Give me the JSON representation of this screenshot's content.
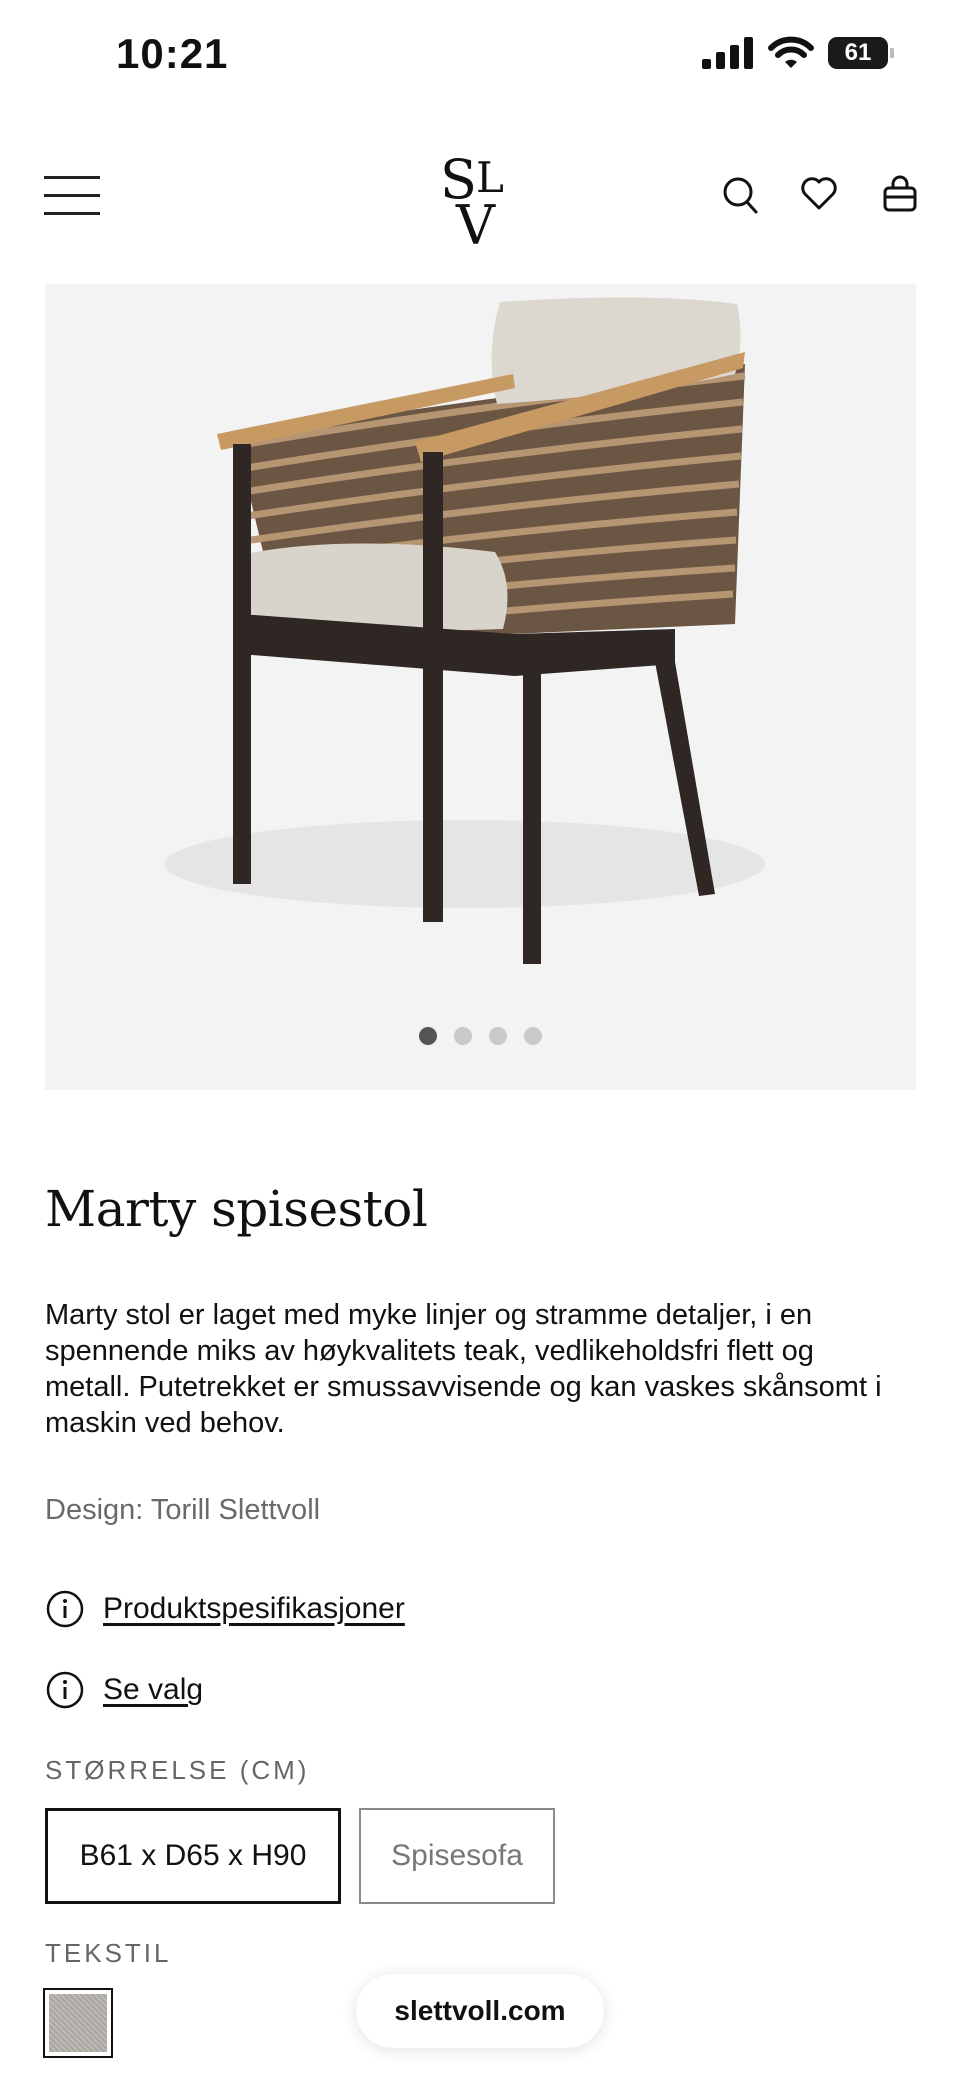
{
  "status_bar": {
    "time": "10:21",
    "battery": "61"
  },
  "header": {
    "icons": [
      "menu-icon",
      "search-icon",
      "heart-icon",
      "bag-icon"
    ]
  },
  "gallery": {
    "image_alt": "Marty spisestol",
    "slide_count": 4,
    "active_slide": 1
  },
  "product": {
    "title": "Marty spisestol",
    "description": "Marty stol er laget med myke linjer og stramme detaljer, i en spennende miks av høykvalitets teak, vedlikeholdsfri flett og metall. Putetrekket er smussavvisende og kan vaskes skånsomt i maskin ved behov.",
    "designer": "Design: Torill Slettvoll",
    "spec_link": "Produktspesifikasjoner",
    "options_link": "Se valg",
    "size_label": "STØRRELSE (CM)",
    "sizes": [
      "B61 x D65 x H90",
      "Spisesofa"
    ],
    "selected_size": "B61 x D65 x H90",
    "textile_label": "TEKSTIL"
  },
  "browser": {
    "url": "slettvoll.com"
  },
  "colors": {
    "background": "#ffffff",
    "gallery_bg": "#f3f3f3",
    "text": "#111111",
    "muted": "#6a6a6a"
  }
}
